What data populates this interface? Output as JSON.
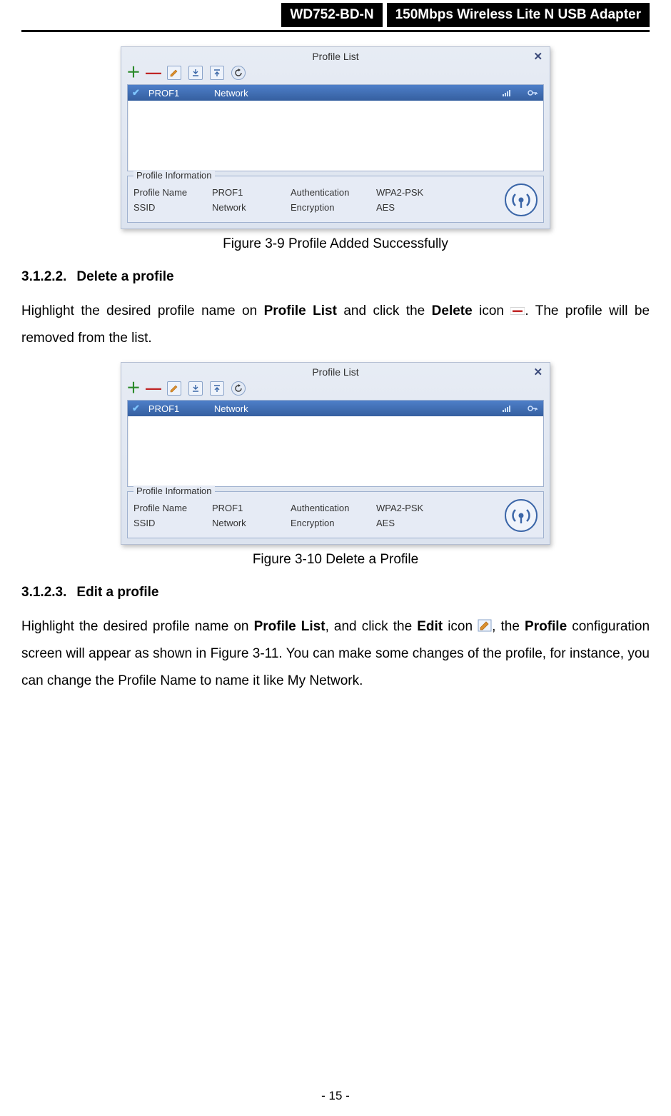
{
  "header": {
    "model": "WD752-BD-N",
    "title": "150Mbps Wireless Lite N USB Adapter"
  },
  "figures": {
    "fig1": {
      "caption": "Figure 3-9 Profile Added Successfully",
      "title": "Profile List",
      "legend": "Profile Information",
      "row": {
        "name": "PROF1",
        "ssid": "Network"
      },
      "labels": {
        "profileName": "Profile Name",
        "ssid": "SSID",
        "authentication": "Authentication",
        "encryption": "Encryption"
      },
      "values": {
        "profileName": "PROF1",
        "ssid": "Network",
        "authentication": "WPA2-PSK",
        "encryption": "AES"
      }
    },
    "fig2": {
      "caption": "Figure 3-10 Delete a Profile",
      "title": "Profile List",
      "legend": "Profile Information",
      "row": {
        "name": "PROF1",
        "ssid": "Network"
      },
      "labels": {
        "profileName": "Profile Name",
        "ssid": "SSID",
        "authentication": "Authentication",
        "encryption": "Encryption"
      },
      "values": {
        "profileName": "PROF1",
        "ssid": "Network",
        "authentication": "WPA2-PSK",
        "encryption": "AES"
      }
    }
  },
  "sections": {
    "s1": {
      "num": "3.1.2.2.",
      "title": "Delete a profile",
      "text_before": "Highlight the desired profile name on ",
      "bold1": "Profile List",
      "text_mid": " and click the ",
      "bold2": "Delete",
      "text_after_icon": ". The profile will be removed from the list.",
      "icon_word": " icon "
    },
    "s2": {
      "num": "3.1.2.3.",
      "title": "Edit a profile",
      "t1": "Highlight the desired profile name on ",
      "b1": "Profile List",
      "t2": ", and click the ",
      "b2": "Edit",
      "t3": " icon ",
      "t4": ", the ",
      "b3": "Profile",
      "t5": " configuration screen will appear as shown in Figure 3-11. You can make some changes of the profile, for instance, you can change the Profile Name to name it like My Network."
    }
  },
  "pageNumber": "- 15 -"
}
